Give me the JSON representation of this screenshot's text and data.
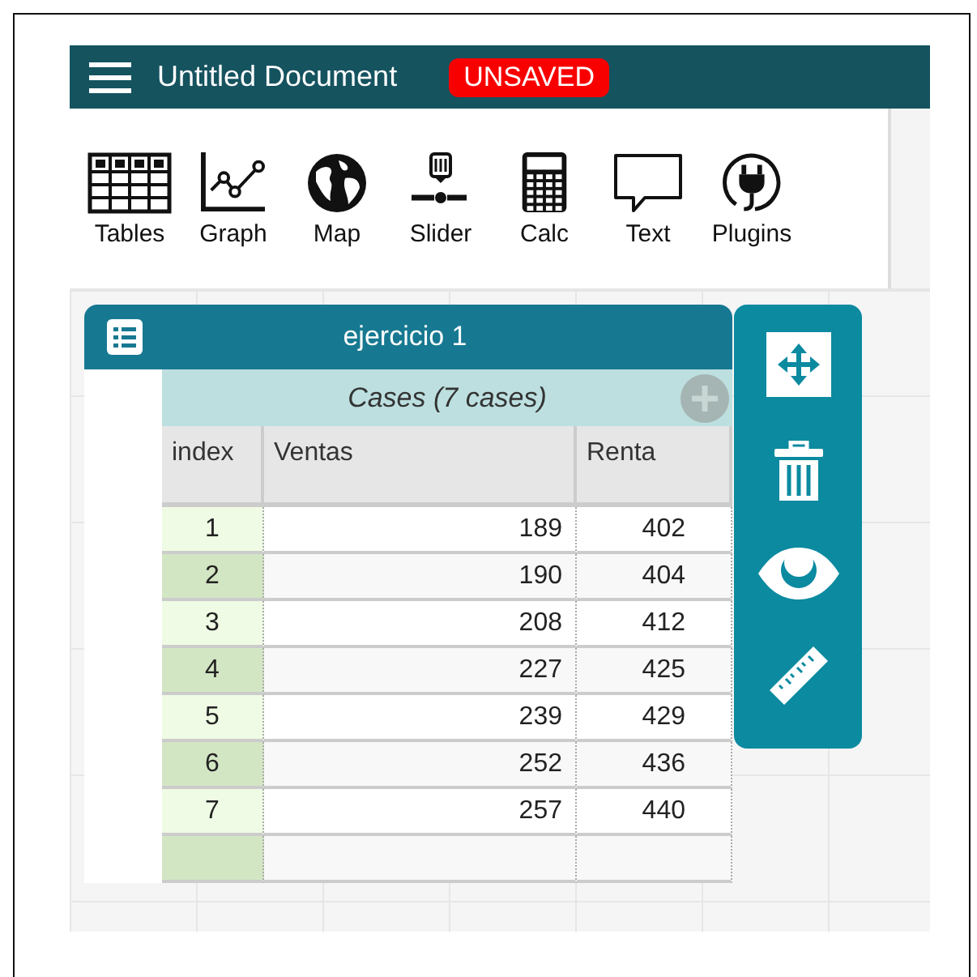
{
  "header": {
    "title": "Untitled Document",
    "badge": "UNSAVED"
  },
  "toolbar": [
    {
      "kind": "table",
      "label": "Tables"
    },
    {
      "kind": "graph",
      "label": "Graph"
    },
    {
      "kind": "map",
      "label": "Map"
    },
    {
      "kind": "slider",
      "label": "Slider"
    },
    {
      "kind": "calc",
      "label": "Calc"
    },
    {
      "kind": "text",
      "label": "Text"
    },
    {
      "kind": "plugins",
      "label": "Plugins"
    }
  ],
  "table_card": {
    "title": "ejercicio 1",
    "collection": "Cases (7 cases)",
    "columns": [
      "index",
      "Ventas",
      "Renta"
    ],
    "rows": [
      [
        "1",
        "189",
        "402"
      ],
      [
        "2",
        "190",
        "404"
      ],
      [
        "3",
        "208",
        "412"
      ],
      [
        "4",
        "227",
        "425"
      ],
      [
        "5",
        "239",
        "429"
      ],
      [
        "6",
        "252",
        "436"
      ],
      [
        "7",
        "257",
        "440"
      ]
    ]
  },
  "tile_toolbar": [
    {
      "kind": "move"
    },
    {
      "kind": "delete"
    },
    {
      "kind": "hide"
    },
    {
      "kind": "ruler"
    }
  ]
}
